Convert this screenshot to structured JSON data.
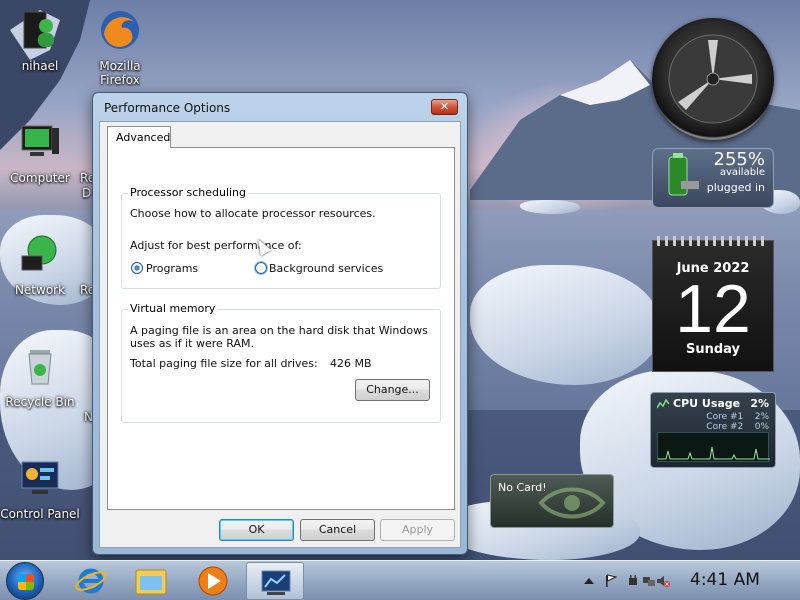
{
  "desktop": {
    "icons": [
      {
        "label": "nihael"
      },
      {
        "label": "Mozilla Firefox"
      },
      {
        "label": "Computer"
      },
      {
        "label": "Network"
      },
      {
        "label": "Recycle Bin"
      },
      {
        "label": "Control Panel"
      }
    ],
    "partial_labels": [
      "Re",
      "D",
      "Re",
      "N"
    ]
  },
  "gadgets": {
    "battery": {
      "percent": "255%",
      "status": "available",
      "state": "plugged in"
    },
    "calendar": {
      "month": "June 2022",
      "day": "12",
      "weekday": "Sunday"
    },
    "cpu": {
      "title": "CPU Usage",
      "total": "2%",
      "cores": [
        {
          "label": "Core #1",
          "value": "2%"
        },
        {
          "label": "Core #2",
          "value": "0%"
        }
      ]
    },
    "nvidia": {
      "text": "No Card!"
    }
  },
  "dialog": {
    "title": "Performance Options",
    "close_label": "✕",
    "tab": "Advanced",
    "processor": {
      "legend": "Processor scheduling",
      "desc": "Choose how to allocate processor resources.",
      "adjust": "Adjust for best performance of:",
      "opt_programs": "Programs",
      "opt_background": "Background services"
    },
    "virtual_memory": {
      "legend": "Virtual memory",
      "desc": "A paging file is an area on the hard disk that Windows uses as if it were RAM.",
      "total_label": "Total paging file size for all drives:",
      "total_value": "426 MB",
      "change_button": "Change..."
    },
    "buttons": {
      "ok": "OK",
      "cancel": "Cancel",
      "apply": "Apply"
    }
  },
  "taskbar": {
    "time": "4:41 AM",
    "pinned": [
      "internet-explorer-icon",
      "windows-explorer-icon",
      "media-player-icon",
      "performance-options-icon"
    ]
  },
  "colors": {
    "accent": "#3c7fb1",
    "dialog_frame": "#a7c1dd",
    "close_red": "#c8442b"
  }
}
